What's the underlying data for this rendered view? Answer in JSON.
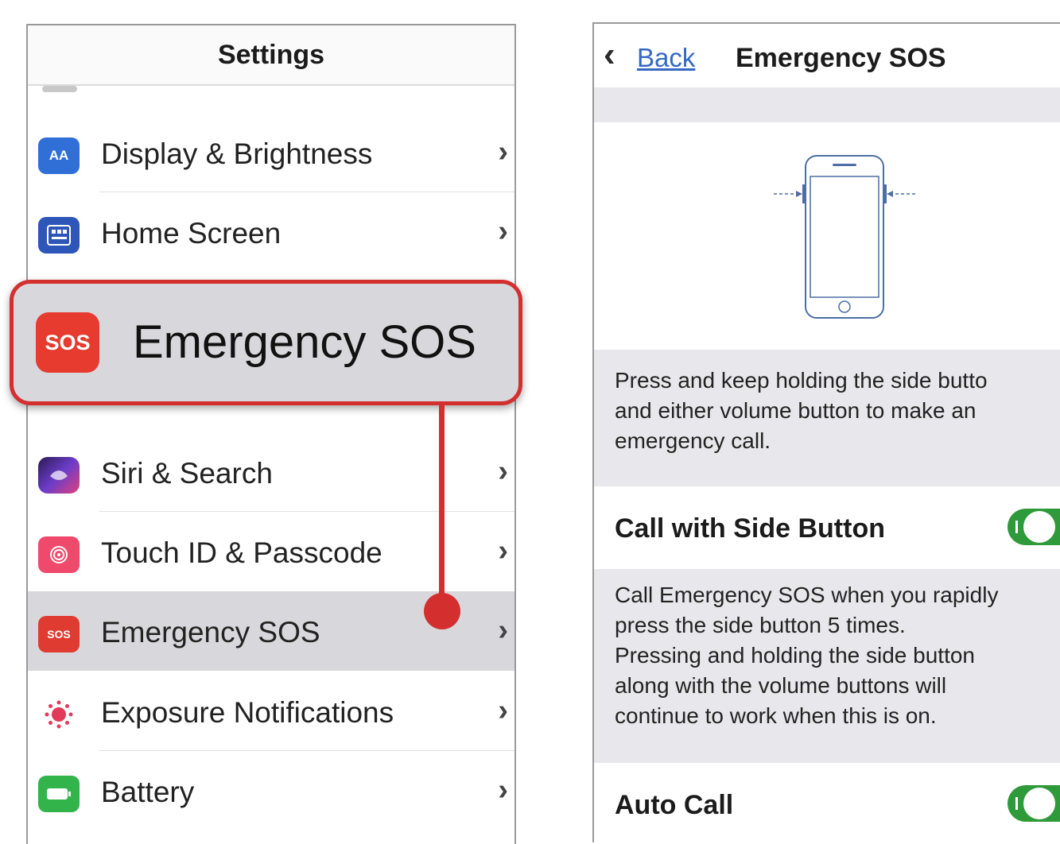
{
  "settings": {
    "title": "Settings",
    "items": [
      {
        "label": "Display & Brightness",
        "icon": "display-brightness-icon",
        "icon_text": "AA"
      },
      {
        "label": "Home Screen",
        "icon": "home-screen-icon",
        "icon_text": ""
      },
      {
        "label": "Siri & Search",
        "icon": "siri-icon",
        "icon_text": ""
      },
      {
        "label": "Touch ID & Passcode",
        "icon": "fingerprint-icon",
        "icon_text": ""
      },
      {
        "label": "Emergency SOS",
        "icon": "sos-icon",
        "icon_text": "SOS"
      },
      {
        "label": "Exposure Notifications",
        "icon": "exposure-notifications-icon",
        "icon_text": ""
      },
      {
        "label": "Battery",
        "icon": "battery-icon",
        "icon_text": ""
      }
    ]
  },
  "callout": {
    "icon_text": "SOS",
    "label": "Emergency SOS"
  },
  "sos_screen": {
    "back_label": "Back",
    "title": "Emergency SOS",
    "intro_lines": [
      "Press and keep holding the side butto",
      "and either volume button to make an",
      "emergency call."
    ],
    "call_side_button": {
      "label": "Call with Side Button",
      "on": true,
      "description_lines": [
        "Call Emergency SOS when you rapidly",
        "press the side button 5 times.",
        "Pressing and holding the side button",
        "along with the volume buttons will",
        "continue to work when this is on."
      ]
    },
    "auto_call": {
      "label": "Auto Call",
      "on": true
    }
  },
  "colors": {
    "accent_red": "#d32f2f",
    "toggle_green": "#2e9a3a",
    "link_blue": "#3468c4"
  }
}
